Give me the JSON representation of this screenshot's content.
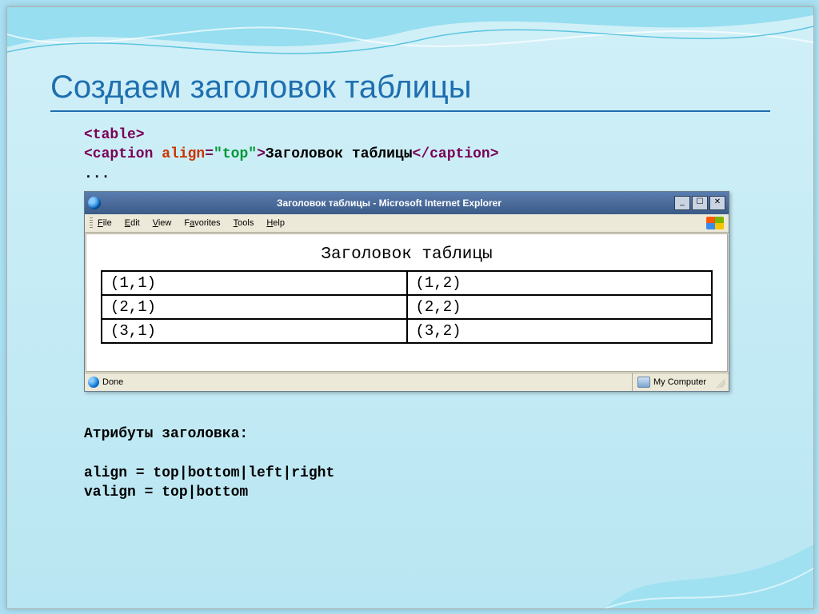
{
  "slide": {
    "title": "Создаем заголовок таблицы"
  },
  "code": {
    "l1_open": "<table>",
    "l2_open": "<caption",
    "l2_attr": " align",
    "l2_eq": "=",
    "l2_val": "\"top\"",
    "l2_gt": ">",
    "l2_text": "Заголовок таблицы",
    "l2_close": "</caption>",
    "l3": "..."
  },
  "browser": {
    "title": "Заголовок таблицы - Microsoft Internet Explorer",
    "menu": [
      "File",
      "Edit",
      "View",
      "Favorites",
      "Tools",
      "Help"
    ],
    "caption": "Заголовок таблицы",
    "table": [
      [
        "(1,1)",
        "(1,2)"
      ],
      [
        "(2,1)",
        "(2,2)"
      ],
      [
        "(3,1)",
        "(3,2)"
      ]
    ],
    "status_left": "Done",
    "status_right": "My Computer"
  },
  "attrs": {
    "heading": "Атрибуты заголовка:",
    "l1": "align = top|bottom|left|right",
    "l2": "valign = top|bottom"
  }
}
